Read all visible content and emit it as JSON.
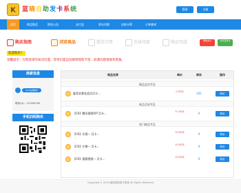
{
  "header": {
    "logo_text": "K",
    "title": "蓝晓自助发卡系统",
    "title_colors": [
      "#e53935",
      "#fb8c00",
      "#fdd835",
      "#43a047",
      "#1e88e5",
      "#8e24aa",
      "#e53935",
      "#43a047"
    ],
    "login_label": "登录",
    "register_label": "注册"
  },
  "nav": {
    "items": [
      {
        "label": "首页",
        "active": true
      },
      {
        "label": "商品购买",
        "active": false
      },
      {
        "label": "财务公告",
        "active": false
      },
      {
        "label": "支付宝",
        "active": false
      },
      {
        "label": "积分兑换",
        "active": false
      },
      {
        "label": "自助卡密",
        "active": false
      },
      {
        "label": "订单查询",
        "active": false
      }
    ]
  },
  "steps": {
    "s1": "购买指南",
    "s2": "浏览商品",
    "s3": "提交订单",
    "s4": "在线付款",
    "s5": "购买完成",
    "tag1": "微信支付",
    "tag2": "支付宝支付"
  },
  "notice": "欢迎购买！",
  "warning": "温馨提示：付款后请勿关闭页面，等待页面自动跳转提取卡密，如遇问题请联系客服。",
  "merchant": {
    "title": "商家信息",
    "qq_label": "QQ 在线联系",
    "contact": "联系QQ：123456789",
    "mobile_title": "手机扫码购买"
  },
  "table": {
    "headers": [
      "商品名称",
      "单价",
      "库存",
      "操作"
    ],
    "categories": [
      "精品会员专区",
      "新品活动专区",
      "热门精品专区"
    ],
    "rows": [
      {
        "name": "爱奇艺黄金会员月卡...",
        "price": "0.50元",
        "stock": "341",
        "buy": "购买"
      },
      {
        "name": "【CK】腾讯视频VIP 月卡...",
        "price": "11.00元",
        "stock": "0",
        "buy": "购买"
      },
      {
        "name": "【CK】乐视一 月卡...",
        "price": "10.00元",
        "stock": "0",
        "buy": "购买"
      },
      {
        "name": "【CK】芒果一 月卡...",
        "price": "10.00元",
        "stock": "0",
        "buy": "购买"
      },
      {
        "name": "【CK】搜狐视频一 月卡...",
        "price": "10.00元",
        "stock": "0",
        "buy": "购买"
      }
    ]
  },
  "footer": {
    "text": "Copyright © 2018 蓝晓自助发卡系统 All Rights Reserved"
  },
  "colors": {
    "primary": "#1e88e5",
    "nav_active": "#f59a23",
    "price": "#e53935",
    "notice_bg": "#ffe600",
    "tag1_bg": "#f44336",
    "tag2_bg": "#4caf50"
  }
}
